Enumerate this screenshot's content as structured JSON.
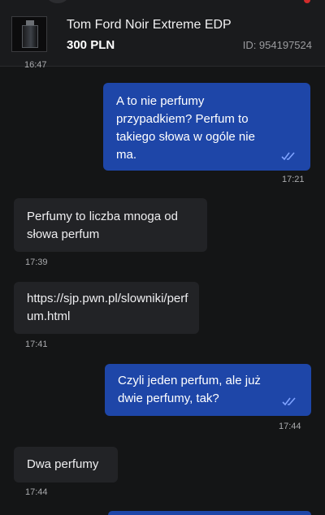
{
  "header": {
    "product_title": "Tom Ford Noir Extreme EDP",
    "price": "300 PLN",
    "product_id": "ID: 954197524",
    "previous_time": "16:47"
  },
  "messages": [
    {
      "direction": "out",
      "text": "A to nie perfumy przypadkiem? Perfum to takiego słowa w ogóle nie ma.",
      "time": "17:21",
      "read": true
    },
    {
      "direction": "in",
      "text": "Perfumy to liczba mnoga od słowa perfum",
      "time": "17:39"
    },
    {
      "direction": "in",
      "text": "https://sjp.pwn.pl/slowniki/perfum.html",
      "time": "17:41"
    },
    {
      "direction": "out",
      "text": "Czyli jeden perfum, ale już dwie perfumy, tak?",
      "time": "17:44",
      "read": true
    },
    {
      "direction": "in",
      "text": "Dwa perfumy",
      "time": "17:44"
    }
  ],
  "colors": {
    "outgoing_bubble": "#1e46a8",
    "incoming_bubble": "#222326",
    "background": "#141516",
    "read_ticks": "#7fa3ff"
  }
}
